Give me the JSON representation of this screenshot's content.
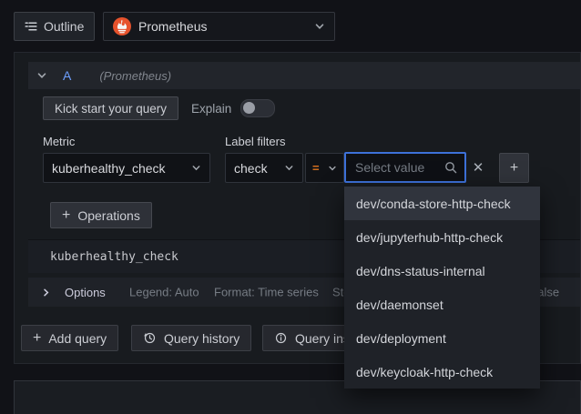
{
  "topbar": {
    "outline_button": "Outline",
    "datasource_picker": {
      "value": "Prometheus"
    }
  },
  "query_row": {
    "ref_id": "A",
    "datasource_hint": "(Prometheus)",
    "kickstart_button": "Kick start your query",
    "explain_label": "Explain",
    "explain_enabled": false,
    "metric_label": "Metric",
    "metric_value": "kuberhealthy_check",
    "label_filters_label": "Label filters",
    "filter": {
      "label_name": "check",
      "operator": "=",
      "value_placeholder": "Select value"
    },
    "operations_button": "Operations",
    "query_preview": "kuberhealthy_check",
    "options_bar": {
      "title": "Options",
      "legend": "Legend: Auto",
      "format": "Format: Time series",
      "step": "Step: auto",
      "exemplars": "Exemplars: false"
    }
  },
  "footer": {
    "add_query_button": "Add query",
    "query_history_button": "Query history",
    "query_inspector_button": "Query inspector"
  },
  "value_dropdown": {
    "active_index": 0,
    "items": [
      "dev/conda-store-http-check",
      "dev/jupyterhub-http-check",
      "dev/dns-status-internal",
      "dev/daemonset",
      "dev/deployment",
      "dev/keycloak-http-check"
    ]
  },
  "colors": {
    "page_bg": "#111217",
    "panel_bg": "#181b1f",
    "focus_blue": "#3d71d9",
    "ref_id_blue": "#6e9fff",
    "operator_orange": "#e0751f",
    "prometheus_orange": "#e6522c"
  }
}
